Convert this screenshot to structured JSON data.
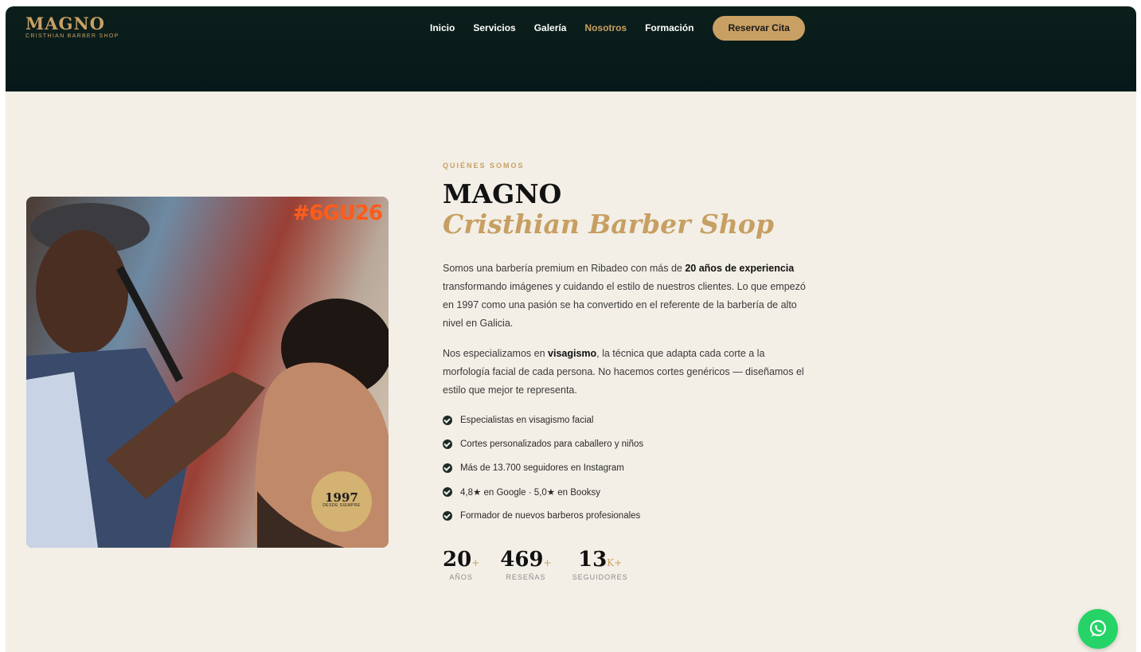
{
  "brand": {
    "title": "MAGNO",
    "subtitle": "CRISTHIAN BARBER SHOP"
  },
  "nav": {
    "items": [
      "Inicio",
      "Servicios",
      "Galería",
      "Nosotros",
      "Formación"
    ],
    "active": "Nosotros",
    "cta_label": "Reservar Cita"
  },
  "photo": {
    "tag": "#6GU26",
    "badge_year": "1997",
    "badge_sub": "DESDE SIEMPRE"
  },
  "about": {
    "eyebrow": "QUIÉNES SOMOS",
    "title": "MAGNO",
    "subtitle": "Cristhian Barber Shop",
    "p1_a": "Somos una barbería premium en Ribadeo con más de ",
    "p1_b": "20 años de experiencia",
    "p1_c": " transformando imágenes y cuidando el estilo de nuestros clientes. Lo que empezó en 1997 como una pasión se ha convertido en el referente de la barbería de alto nivel en Galicia.",
    "p2_a": "Nos especializamos en ",
    "p2_b": "visagismo",
    "p2_c": ", la técnica que adapta cada corte a la morfología facial de cada persona. No hacemos cortes genéricos — diseñamos el estilo que mejor te representa.",
    "checks": [
      "Especialistas en visagismo facial",
      "Cortes personalizados para caballero y niños",
      "Más de 13.700 seguidores en Instagram",
      "4,8★ en Google · 5,0★ en Booksy",
      "Formador de nuevos barberos profesionales"
    ],
    "stats": [
      {
        "value": "20",
        "suffix": "+",
        "label": "AÑOS"
      },
      {
        "value": "469",
        "suffix": "+",
        "label": "RESEÑAS"
      },
      {
        "value": "13",
        "suffix": "K+",
        "label": "SEGUIDORES"
      }
    ]
  },
  "icons": {
    "check": "check-circle-icon",
    "whatsapp": "whatsapp-icon"
  },
  "colors": {
    "header_bg": "#0c1f1b",
    "accent_gold": "#c9a063",
    "page_bg": "#f3efe7",
    "whatsapp_green": "#25d366"
  }
}
